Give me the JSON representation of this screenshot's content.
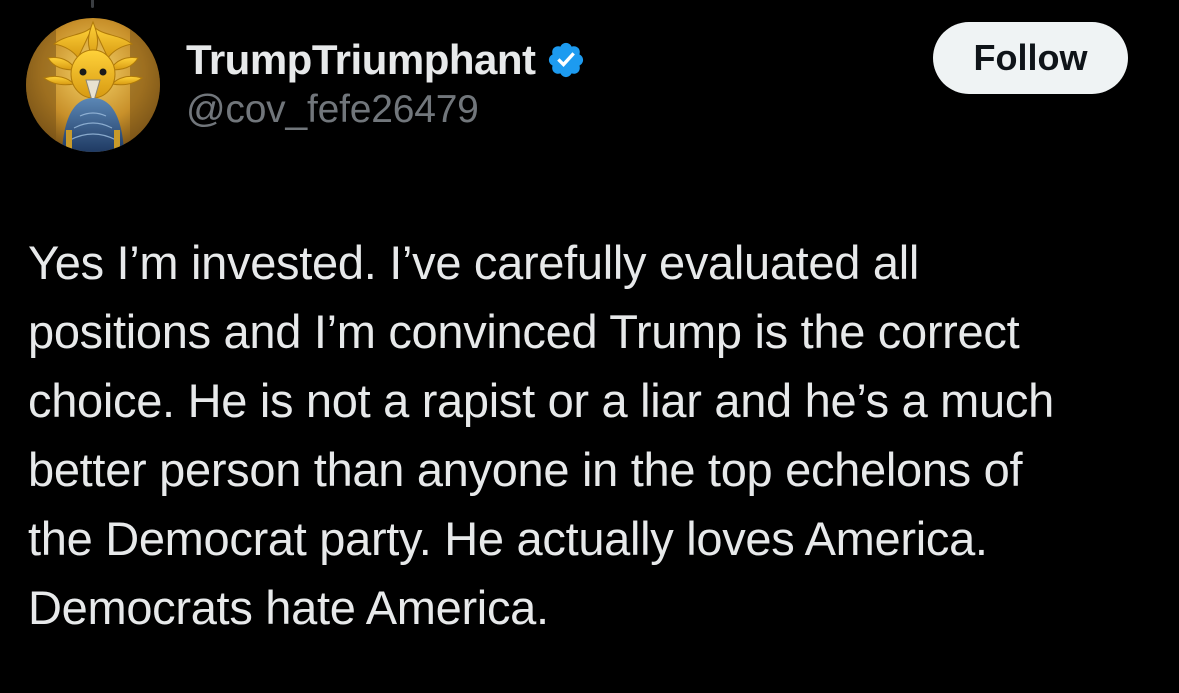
{
  "author": {
    "display_name": "TrumpTriumphant",
    "handle": "@cov_fefe26479",
    "verified": true,
    "avatar_icon": "golden-eagle-avatar"
  },
  "follow_button": {
    "label": "Follow"
  },
  "tweet": {
    "lines": [
      "Yes I’m invested. I’ve carefully evaluated all",
      "positions and I’m convinced Trump is the correct",
      "choice. He is not a rapist or a liar and he’s a much",
      "better person than anyone in the top echelons of",
      "the Democrat party. He actually loves America.",
      "Democrats hate America."
    ]
  },
  "colors": {
    "background": "#000000",
    "primary_text": "#e7e9ea",
    "secondary_text": "#71767b",
    "verified_blue": "#1d9bf0",
    "follow_button_bg": "#eff3f4",
    "follow_button_text": "#0f1419"
  }
}
